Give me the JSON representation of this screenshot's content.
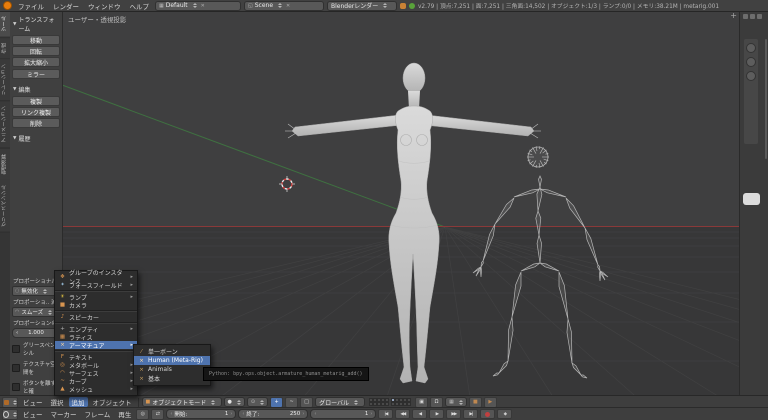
{
  "info_bar": {
    "menus": [
      {
        "label": "ファイル"
      },
      {
        "label": "レンダー"
      },
      {
        "label": "ウィンドウ"
      },
      {
        "label": "ヘルプ"
      }
    ],
    "layout": {
      "value": "Default"
    },
    "scene": {
      "value": "Scene"
    },
    "engine": {
      "value": "Blenderレンダー"
    },
    "stats": "v2.79 | 頂点:7,251 | 面:7,251 | 三角面:14,502 | オブジェクト:1/3 | ランプ:0/0 | メモリ:38.21M | metarig.001"
  },
  "tool_shelf": {
    "tabs": [
      {
        "label": "ツール",
        "active": true
      },
      {
        "label": "作成"
      },
      {
        "label": "リレーション"
      },
      {
        "label": "アニメーション"
      },
      {
        "label": "物理演算"
      },
      {
        "label": "グリースペンシル"
      }
    ],
    "transform_panel": {
      "title": "トランスフォーム",
      "buttons": [
        {
          "label": "移動"
        },
        {
          "label": "回転"
        },
        {
          "label": "拡大縮小"
        },
        {
          "label": "ミラー"
        }
      ]
    },
    "edit_panel": {
      "title": "編集",
      "buttons": [
        {
          "label": "複製"
        },
        {
          "label": "リンク複製"
        },
        {
          "label": "削除"
        }
      ]
    },
    "history_panel": {
      "title": "履歴"
    },
    "operator_panel": {
      "proportional_label": "プロポーショナル編集",
      "proportional_value": "無効化",
      "falloff_label": "プロポーショ.. 減衰タイ",
      "falloff_value": "スムーズ",
      "size_label": "プロポーションのサイ",
      "size_value": "1.000",
      "checkboxes": [
        {
          "label": "グリースペンシル"
        },
        {
          "label": "テクスチャ空間を"
        },
        {
          "label": "ボタンを離すと確"
        }
      ]
    }
  },
  "viewport": {
    "view_label": "ユーザー・透視投影",
    "add_panel_button": "+",
    "colors": {
      "background_top": "#3f3f40",
      "background_bottom": "#373738",
      "x_axis": "#8a3939",
      "y_axis": "#3f7140",
      "mesh_fill": "#cccccc",
      "armature": "#b6b6b6",
      "cursor_red": "#d84040",
      "menu_highlight": "#4e73ae"
    }
  },
  "add_menu": {
    "items": [
      {
        "label": "グループのインスタンス",
        "icon": "group-instance-icon",
        "has_submenu": true,
        "icon_color": "#d89550"
      },
      {
        "label": "フォースフィールド",
        "icon": "force-field-icon",
        "has_submenu": true,
        "icon_color": "#8fb2cc"
      },
      {
        "label": "ランプ",
        "icon": "lamp-icon",
        "has_submenu": true,
        "icon_color": "#e0c040"
      },
      {
        "label": "カメラ",
        "icon": "camera-icon",
        "has_submenu": false,
        "icon_color": "#d89550"
      },
      {
        "label": "スピーカー",
        "icon": "speaker-icon",
        "has_submenu": false,
        "icon_color": "#d89550"
      },
      {
        "label": "エンプティ",
        "icon": "empty-icon",
        "has_submenu": true,
        "icon_color": "#b0b0b0"
      },
      {
        "label": "ラティス",
        "icon": "lattice-icon",
        "has_submenu": false,
        "icon_color": "#d89550"
      },
      {
        "label": "アーマチュア",
        "icon": "armature-icon",
        "has_submenu": true,
        "highlighted": true,
        "icon_color": "#d89550"
      },
      {
        "label": "テキスト",
        "icon": "text-icon",
        "has_submenu": false,
        "icon_color": "#d89550"
      },
      {
        "label": "メタボール",
        "icon": "metaball-icon",
        "has_submenu": true,
        "icon_color": "#d89550"
      },
      {
        "label": "サーフェス",
        "icon": "surface-icon",
        "has_submenu": true,
        "icon_color": "#d89550"
      },
      {
        "label": "カーブ",
        "icon": "curve-icon",
        "has_submenu": true,
        "icon_color": "#d89550"
      },
      {
        "label": "メッシュ",
        "icon": "mesh-icon",
        "has_submenu": true,
        "icon_color": "#d89550"
      }
    ]
  },
  "armature_submenu": {
    "items": [
      {
        "label": "単一ボーン",
        "icon": "bone-icon"
      },
      {
        "label": "Human (Meta-Rig)",
        "icon": "armature-icon",
        "highlighted": true
      },
      {
        "label": "Animals",
        "icon": "armature-icon",
        "has_submenu": true
      },
      {
        "label": "基本",
        "icon": "armature-icon",
        "has_submenu": true
      }
    ]
  },
  "tooltip": {
    "text": "Python: bpy.ops.object.armature_human_metarig_add()"
  },
  "viewport_header": {
    "menus": [
      {
        "label": "ビュー"
      },
      {
        "label": "選択"
      },
      {
        "label": "追加",
        "active": true
      },
      {
        "label": "オブジェクト"
      }
    ],
    "mode": "オブジェクトモード",
    "orientation": "グローバル"
  },
  "timeline": {
    "menus": [
      {
        "label": "ビュー"
      },
      {
        "label": "マーカー"
      },
      {
        "label": "フレーム"
      },
      {
        "label": "再生"
      }
    ],
    "start_label": "開始:",
    "start_value": "1",
    "end_label": "終了:",
    "end_value": "250",
    "current_frame": "1"
  }
}
